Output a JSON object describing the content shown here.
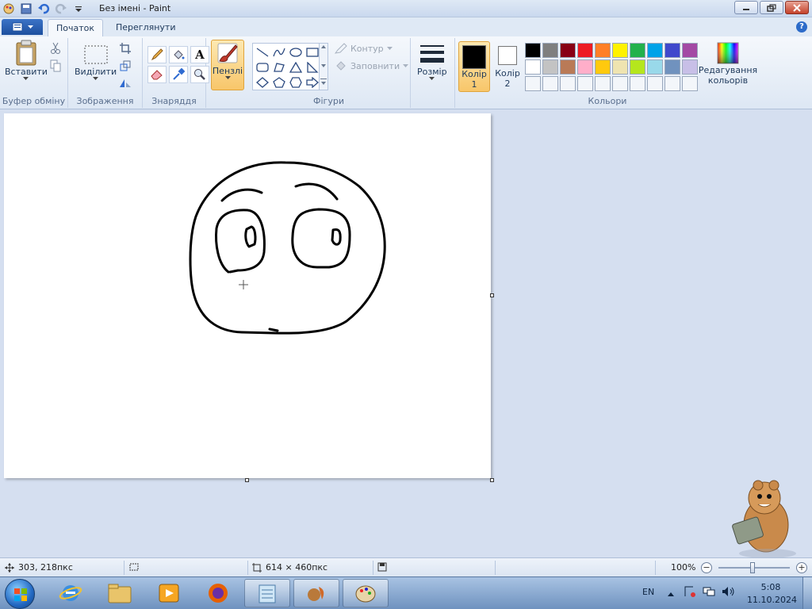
{
  "window": {
    "title": "Без імені - Paint"
  },
  "tabs": [
    {
      "label": "Початок",
      "active": true
    },
    {
      "label": "Переглянути",
      "active": false
    }
  ],
  "ribbon": {
    "clipboard": {
      "paste_label": "Вставити",
      "group_label": "Буфер обміну"
    },
    "image": {
      "select_label": "Виділити",
      "group_label": "Зображення"
    },
    "tools": {
      "group_label": "Знаряддя"
    },
    "brushes": {
      "label": "Пензлі"
    },
    "shapes": {
      "outline_label": "Контур",
      "fill_label": "Заповнити",
      "group_label": "Фігури"
    },
    "size": {
      "label": "Розмір"
    },
    "colors": {
      "color1_label": "Колір",
      "color1_num": "1",
      "color2_label": "Колір",
      "color2_num": "2",
      "edit_line1": "Редагування",
      "edit_line2": "кольорів",
      "group_label": "Кольори",
      "color1_value": "#000000",
      "color2_value": "#ffffff",
      "palette": [
        "#000000",
        "#7f7f7f",
        "#880015",
        "#ed1c24",
        "#ff7f27",
        "#fff200",
        "#22b14c",
        "#00a2e8",
        "#3f48cc",
        "#a349a4",
        "#ffffff",
        "#c3c3c3",
        "#b97a57",
        "#ffaec9",
        "#ffc90e",
        "#efe4b0",
        "#b5e61d",
        "#99d9ea",
        "#7092be",
        "#c8bfe7",
        "#f3f6fa",
        "#f3f6fa",
        "#f3f6fa",
        "#f3f6fa",
        "#f3f6fa",
        "#f3f6fa",
        "#f3f6fa",
        "#f3f6fa",
        "#f3f6fa",
        "#f3f6fa"
      ]
    }
  },
  "status": {
    "cursor_pos": "303, 218пкс",
    "canvas_size": "614 × 460пкс",
    "zoom": "100%"
  },
  "taskbar": {
    "lang": "EN",
    "time": "5:08",
    "date": "11.10.2024"
  }
}
